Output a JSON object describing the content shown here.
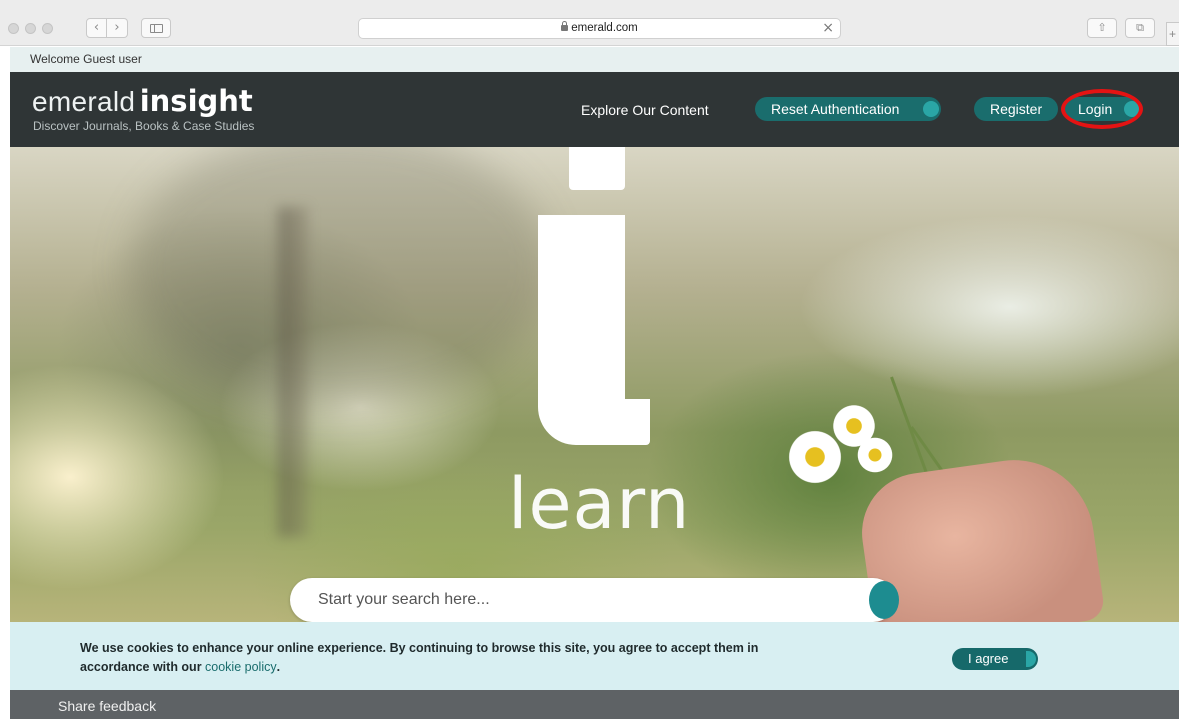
{
  "browser": {
    "url": "emerald.com",
    "back_glyph": "‹",
    "forward_glyph": "›",
    "close_glyph": "×",
    "share_glyph": "⇧",
    "tabs_glyph": "⧉",
    "new_tab_glyph": "+"
  },
  "welcome": {
    "text": "Welcome Guest user"
  },
  "header": {
    "logo_word1": "emerald",
    "logo_word2": "insight",
    "tagline": "Discover Journals, Books & Case Studies",
    "nav": {
      "explore": "Explore Our Content",
      "reset": "Reset Authentication",
      "register": "Register",
      "login": "Login"
    }
  },
  "hero": {
    "big_letter": "i",
    "word": "learn",
    "search_placeholder": "Start your search here..."
  },
  "cookie": {
    "text_before_link": "We use cookies to enhance your online experience. By continuing to browse this site, you agree to accept them in accordance with our ",
    "link_text": "cookie policy",
    "text_after_link": ".",
    "agree_label": "I agree"
  },
  "footer": {
    "feedback_label": "Share feedback"
  },
  "colors": {
    "header_bg": "#2f3536",
    "accent_teal": "#1a6d6d",
    "knob_teal": "#2aa6a6",
    "cookie_bg": "#d8eff2",
    "annotation_red": "#e41313"
  }
}
